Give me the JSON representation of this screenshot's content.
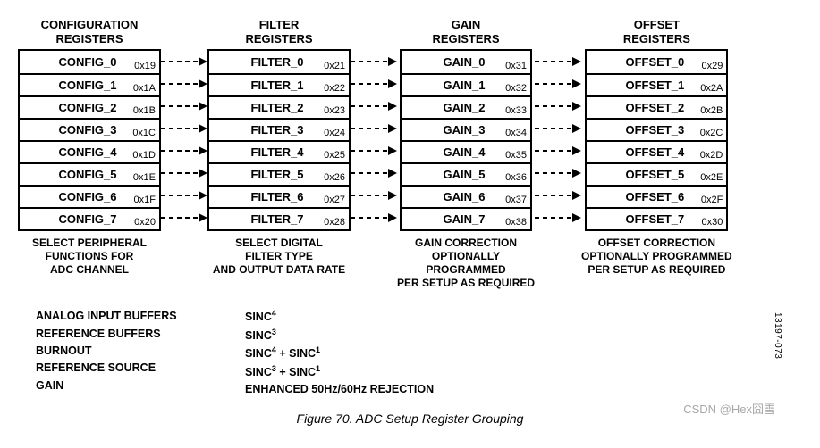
{
  "columns": [
    {
      "title": "CONFIGURATION\nREGISTERS",
      "desc": "SELECT PERIPHERAL\nFUNCTIONS FOR\nADC CHANNEL",
      "regs": [
        {
          "name": "CONFIG_0",
          "addr": "0x19"
        },
        {
          "name": "CONFIG_1",
          "addr": "0x1A"
        },
        {
          "name": "CONFIG_2",
          "addr": "0x1B"
        },
        {
          "name": "CONFIG_3",
          "addr": "0x1C"
        },
        {
          "name": "CONFIG_4",
          "addr": "0x1D"
        },
        {
          "name": "CONFIG_5",
          "addr": "0x1E"
        },
        {
          "name": "CONFIG_6",
          "addr": "0x1F"
        },
        {
          "name": "CONFIG_7",
          "addr": "0x20"
        }
      ]
    },
    {
      "title": "FILTER\nREGISTERS",
      "desc": "SELECT DIGITAL\nFILTER TYPE\nAND OUTPUT DATA RATE",
      "regs": [
        {
          "name": "FILTER_0",
          "addr": "0x21"
        },
        {
          "name": "FILTER_1",
          "addr": "0x22"
        },
        {
          "name": "FILTER_2",
          "addr": "0x23"
        },
        {
          "name": "FILTER_3",
          "addr": "0x24"
        },
        {
          "name": "FILTER_4",
          "addr": "0x25"
        },
        {
          "name": "FILTER_5",
          "addr": "0x26"
        },
        {
          "name": "FILTER_6",
          "addr": "0x27"
        },
        {
          "name": "FILTER_7",
          "addr": "0x28"
        }
      ]
    },
    {
      "title": "GAIN\nREGISTERS",
      "desc": "GAIN CORRECTION\nOPTIONALLY\nPROGRAMMED\nPER SETUP AS REQUIRED",
      "regs": [
        {
          "name": "GAIN_0",
          "addr": "0x31"
        },
        {
          "name": "GAIN_1",
          "addr": "0x32"
        },
        {
          "name": "GAIN_2",
          "addr": "0x33"
        },
        {
          "name": "GAIN_3",
          "addr": "0x34"
        },
        {
          "name": "GAIN_4",
          "addr": "0x35"
        },
        {
          "name": "GAIN_5",
          "addr": "0x36"
        },
        {
          "name": "GAIN_6",
          "addr": "0x37"
        },
        {
          "name": "GAIN_7",
          "addr": "0x38"
        }
      ]
    },
    {
      "title": "OFFSET\nREGISTERS",
      "desc": "OFFSET CORRECTION\nOPTIONALLY PROGRAMMED\nPER SETUP AS REQUIRED",
      "regs": [
        {
          "name": "OFFSET_0",
          "addr": "0x29"
        },
        {
          "name": "OFFSET_1",
          "addr": "0x2A"
        },
        {
          "name": "OFFSET_2",
          "addr": "0x2B"
        },
        {
          "name": "OFFSET_3",
          "addr": "0x2C"
        },
        {
          "name": "OFFSET_4",
          "addr": "0x2D"
        },
        {
          "name": "OFFSET_5",
          "addr": "0x2E"
        },
        {
          "name": "OFFSET_6",
          "addr": "0x2F"
        },
        {
          "name": "OFFSET_7",
          "addr": "0x30"
        }
      ]
    }
  ],
  "bottom_left": [
    "ANALOG INPUT BUFFERS",
    "REFERENCE BUFFERS",
    "BURNOUT",
    "REFERENCE SOURCE",
    "GAIN"
  ],
  "bottom_right_html": [
    "SINC<sup>4</sup>",
    "SINC<sup>3</sup>",
    "SINC<sup>4</sup> + SINC<sup>1</sup>",
    "SINC<sup>3</sup> + SINC<sup>1</sup>",
    "ENHANCED 50Hz/60Hz REJECTION"
  ],
  "caption": "Figure 70. ADC Setup Register Grouping",
  "figure_number": "13197-073",
  "watermark": "CSDN @Hex囧雪"
}
